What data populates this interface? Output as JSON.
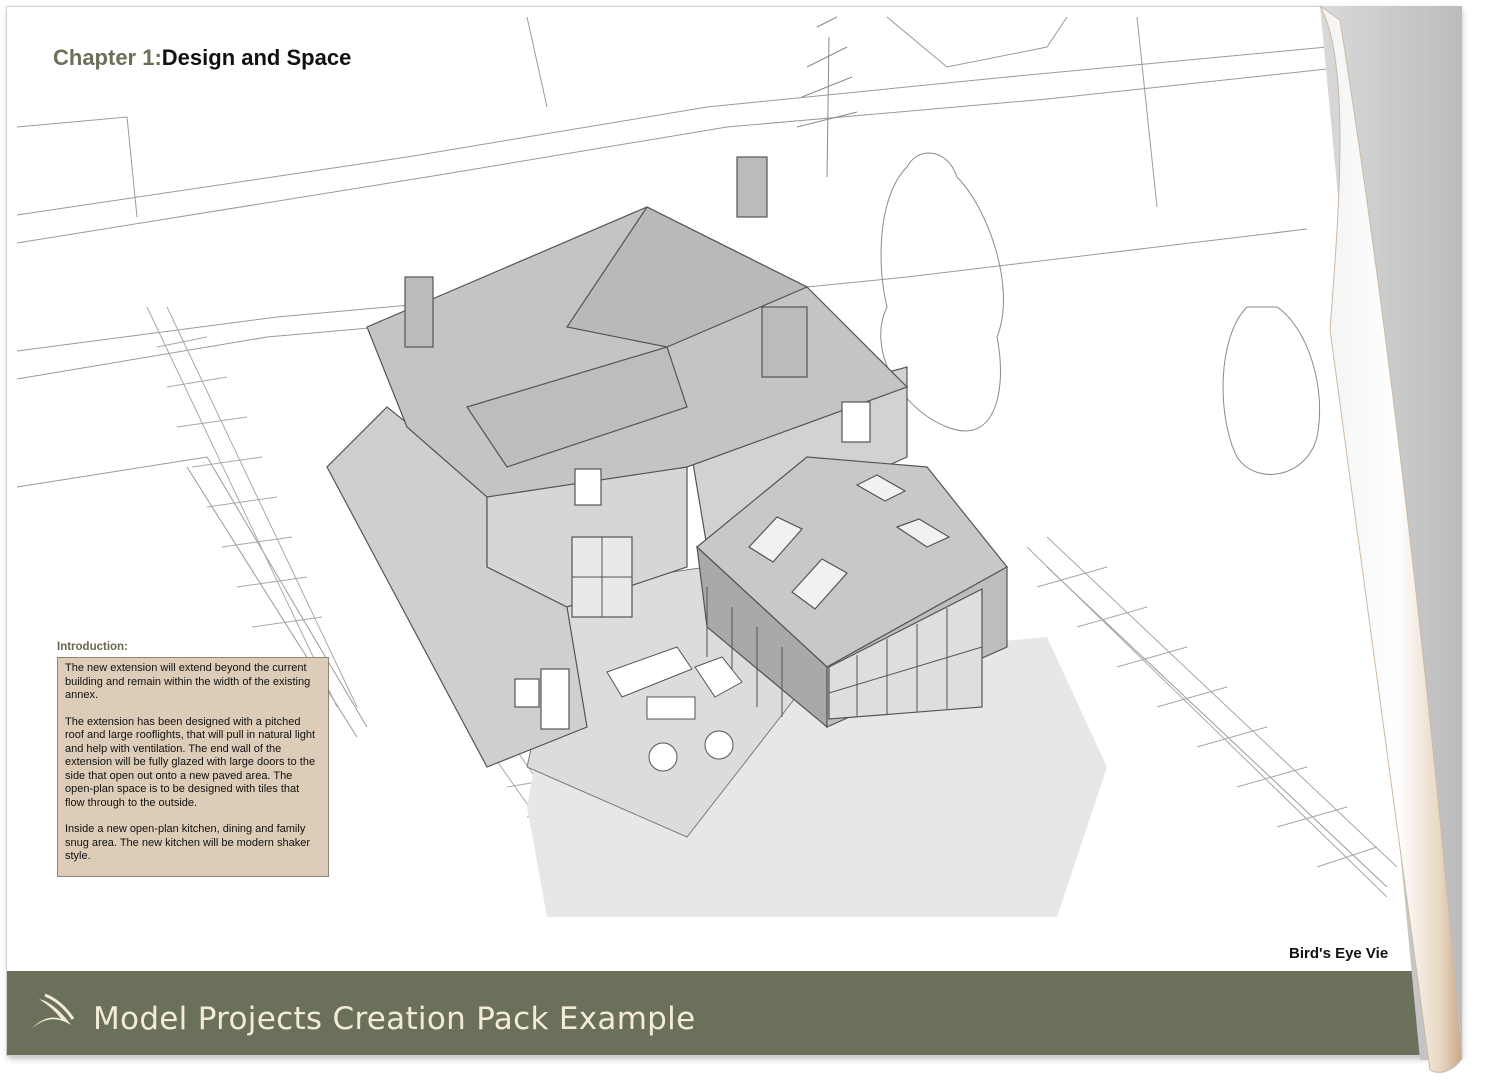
{
  "chapter": {
    "prefix": "Chapter 1:",
    "title": "Design and Space"
  },
  "introduction": {
    "heading": "Introduction:",
    "paragraphs": [
      "The new extension  will  extend beyond the current building and remain within the width of the existing annex.",
      "The extension has been designed with a pitched roof and large rooflights, that will pull in natural light and help with ventilation. The end wall of the extension will be fully glazed with large doors to the side that open out onto a new paved area. The open-plan space is to be designed with tiles that flow  through to the outside.",
      "Inside a new open-plan kitchen, dining and family snug area. The new kitchen will be modern shaker style."
    ]
  },
  "view_label": "Bird's Eye Vie",
  "footer": {
    "title": "Model Projects Creation Pack Example",
    "logo_icon": "swoosh-logo-icon",
    "background_color": "#6b705a",
    "text_color": "#f3ead8"
  },
  "colors": {
    "chapter_prefix": "#6b7058",
    "intro_box": "#ddccb8",
    "intro_heading": "#6b6650"
  }
}
